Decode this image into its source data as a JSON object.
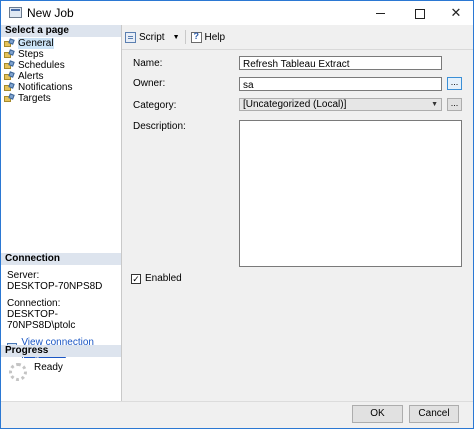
{
  "window": {
    "title": "New Job"
  },
  "left": {
    "select_page_header": "Select a page",
    "pages": [
      {
        "label": "General",
        "selected": true
      },
      {
        "label": "Steps",
        "selected": false
      },
      {
        "label": "Schedules",
        "selected": false
      },
      {
        "label": "Alerts",
        "selected": false
      },
      {
        "label": "Notifications",
        "selected": false
      },
      {
        "label": "Targets",
        "selected": false
      }
    ],
    "connection_header": "Connection",
    "server_label": "Server:",
    "server_value": "DESKTOP-70NPS8D",
    "connection_label": "Connection:",
    "connection_value": "DESKTOP-70NPS8D\\ptolc",
    "view_connection_link": "View connection properties",
    "progress_header": "Progress",
    "progress_status": "Ready"
  },
  "toolbar": {
    "script_label": "Script",
    "help_label": "Help"
  },
  "form": {
    "name_label": "Name:",
    "name_value": "Refresh Tableau Extract",
    "owner_label": "Owner:",
    "owner_value": "sa",
    "owner_browse": "...",
    "category_label": "Category:",
    "category_value": "[Uncategorized (Local)]",
    "category_browse": "...",
    "description_label": "Description:",
    "description_value": "",
    "enabled_label": "Enabled",
    "enabled_checked": true
  },
  "buttons": {
    "ok": "OK",
    "cancel": "Cancel"
  }
}
